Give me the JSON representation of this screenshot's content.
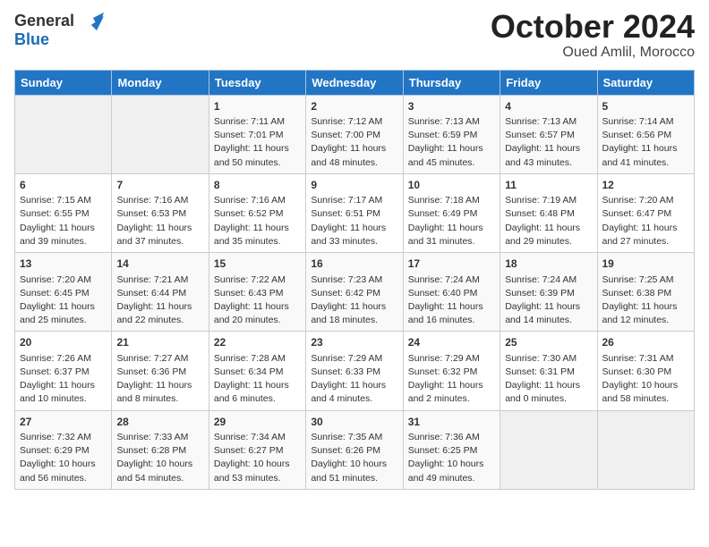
{
  "header": {
    "logo_general": "General",
    "logo_blue": "Blue",
    "title": "October 2024",
    "subtitle": "Oued Amlil, Morocco"
  },
  "weekdays": [
    "Sunday",
    "Monday",
    "Tuesday",
    "Wednesday",
    "Thursday",
    "Friday",
    "Saturday"
  ],
  "weeks": [
    [
      {
        "day": "",
        "empty": true
      },
      {
        "day": "",
        "empty": true
      },
      {
        "day": "1",
        "sunrise": "7:11 AM",
        "sunset": "7:01 PM",
        "daylight": "11 hours and 50 minutes."
      },
      {
        "day": "2",
        "sunrise": "7:12 AM",
        "sunset": "7:00 PM",
        "daylight": "11 hours and 48 minutes."
      },
      {
        "day": "3",
        "sunrise": "7:13 AM",
        "sunset": "6:59 PM",
        "daylight": "11 hours and 45 minutes."
      },
      {
        "day": "4",
        "sunrise": "7:13 AM",
        "sunset": "6:57 PM",
        "daylight": "11 hours and 43 minutes."
      },
      {
        "day": "5",
        "sunrise": "7:14 AM",
        "sunset": "6:56 PM",
        "daylight": "11 hours and 41 minutes."
      }
    ],
    [
      {
        "day": "6",
        "sunrise": "7:15 AM",
        "sunset": "6:55 PM",
        "daylight": "11 hours and 39 minutes."
      },
      {
        "day": "7",
        "sunrise": "7:16 AM",
        "sunset": "6:53 PM",
        "daylight": "11 hours and 37 minutes."
      },
      {
        "day": "8",
        "sunrise": "7:16 AM",
        "sunset": "6:52 PM",
        "daylight": "11 hours and 35 minutes."
      },
      {
        "day": "9",
        "sunrise": "7:17 AM",
        "sunset": "6:51 PM",
        "daylight": "11 hours and 33 minutes."
      },
      {
        "day": "10",
        "sunrise": "7:18 AM",
        "sunset": "6:49 PM",
        "daylight": "11 hours and 31 minutes."
      },
      {
        "day": "11",
        "sunrise": "7:19 AM",
        "sunset": "6:48 PM",
        "daylight": "11 hours and 29 minutes."
      },
      {
        "day": "12",
        "sunrise": "7:20 AM",
        "sunset": "6:47 PM",
        "daylight": "11 hours and 27 minutes."
      }
    ],
    [
      {
        "day": "13",
        "sunrise": "7:20 AM",
        "sunset": "6:45 PM",
        "daylight": "11 hours and 25 minutes."
      },
      {
        "day": "14",
        "sunrise": "7:21 AM",
        "sunset": "6:44 PM",
        "daylight": "11 hours and 22 minutes."
      },
      {
        "day": "15",
        "sunrise": "7:22 AM",
        "sunset": "6:43 PM",
        "daylight": "11 hours and 20 minutes."
      },
      {
        "day": "16",
        "sunrise": "7:23 AM",
        "sunset": "6:42 PM",
        "daylight": "11 hours and 18 minutes."
      },
      {
        "day": "17",
        "sunrise": "7:24 AM",
        "sunset": "6:40 PM",
        "daylight": "11 hours and 16 minutes."
      },
      {
        "day": "18",
        "sunrise": "7:24 AM",
        "sunset": "6:39 PM",
        "daylight": "11 hours and 14 minutes."
      },
      {
        "day": "19",
        "sunrise": "7:25 AM",
        "sunset": "6:38 PM",
        "daylight": "11 hours and 12 minutes."
      }
    ],
    [
      {
        "day": "20",
        "sunrise": "7:26 AM",
        "sunset": "6:37 PM",
        "daylight": "11 hours and 10 minutes."
      },
      {
        "day": "21",
        "sunrise": "7:27 AM",
        "sunset": "6:36 PM",
        "daylight": "11 hours and 8 minutes."
      },
      {
        "day": "22",
        "sunrise": "7:28 AM",
        "sunset": "6:34 PM",
        "daylight": "11 hours and 6 minutes."
      },
      {
        "day": "23",
        "sunrise": "7:29 AM",
        "sunset": "6:33 PM",
        "daylight": "11 hours and 4 minutes."
      },
      {
        "day": "24",
        "sunrise": "7:29 AM",
        "sunset": "6:32 PM",
        "daylight": "11 hours and 2 minutes."
      },
      {
        "day": "25",
        "sunrise": "7:30 AM",
        "sunset": "6:31 PM",
        "daylight": "11 hours and 0 minutes."
      },
      {
        "day": "26",
        "sunrise": "7:31 AM",
        "sunset": "6:30 PM",
        "daylight": "10 hours and 58 minutes."
      }
    ],
    [
      {
        "day": "27",
        "sunrise": "7:32 AM",
        "sunset": "6:29 PM",
        "daylight": "10 hours and 56 minutes."
      },
      {
        "day": "28",
        "sunrise": "7:33 AM",
        "sunset": "6:28 PM",
        "daylight": "10 hours and 54 minutes."
      },
      {
        "day": "29",
        "sunrise": "7:34 AM",
        "sunset": "6:27 PM",
        "daylight": "10 hours and 53 minutes."
      },
      {
        "day": "30",
        "sunrise": "7:35 AM",
        "sunset": "6:26 PM",
        "daylight": "10 hours and 51 minutes."
      },
      {
        "day": "31",
        "sunrise": "7:36 AM",
        "sunset": "6:25 PM",
        "daylight": "10 hours and 49 minutes."
      },
      {
        "day": "",
        "empty": true
      },
      {
        "day": "",
        "empty": true
      }
    ]
  ],
  "labels": {
    "sunrise_prefix": "Sunrise: ",
    "sunset_prefix": "Sunset: ",
    "daylight_prefix": "Daylight: "
  }
}
